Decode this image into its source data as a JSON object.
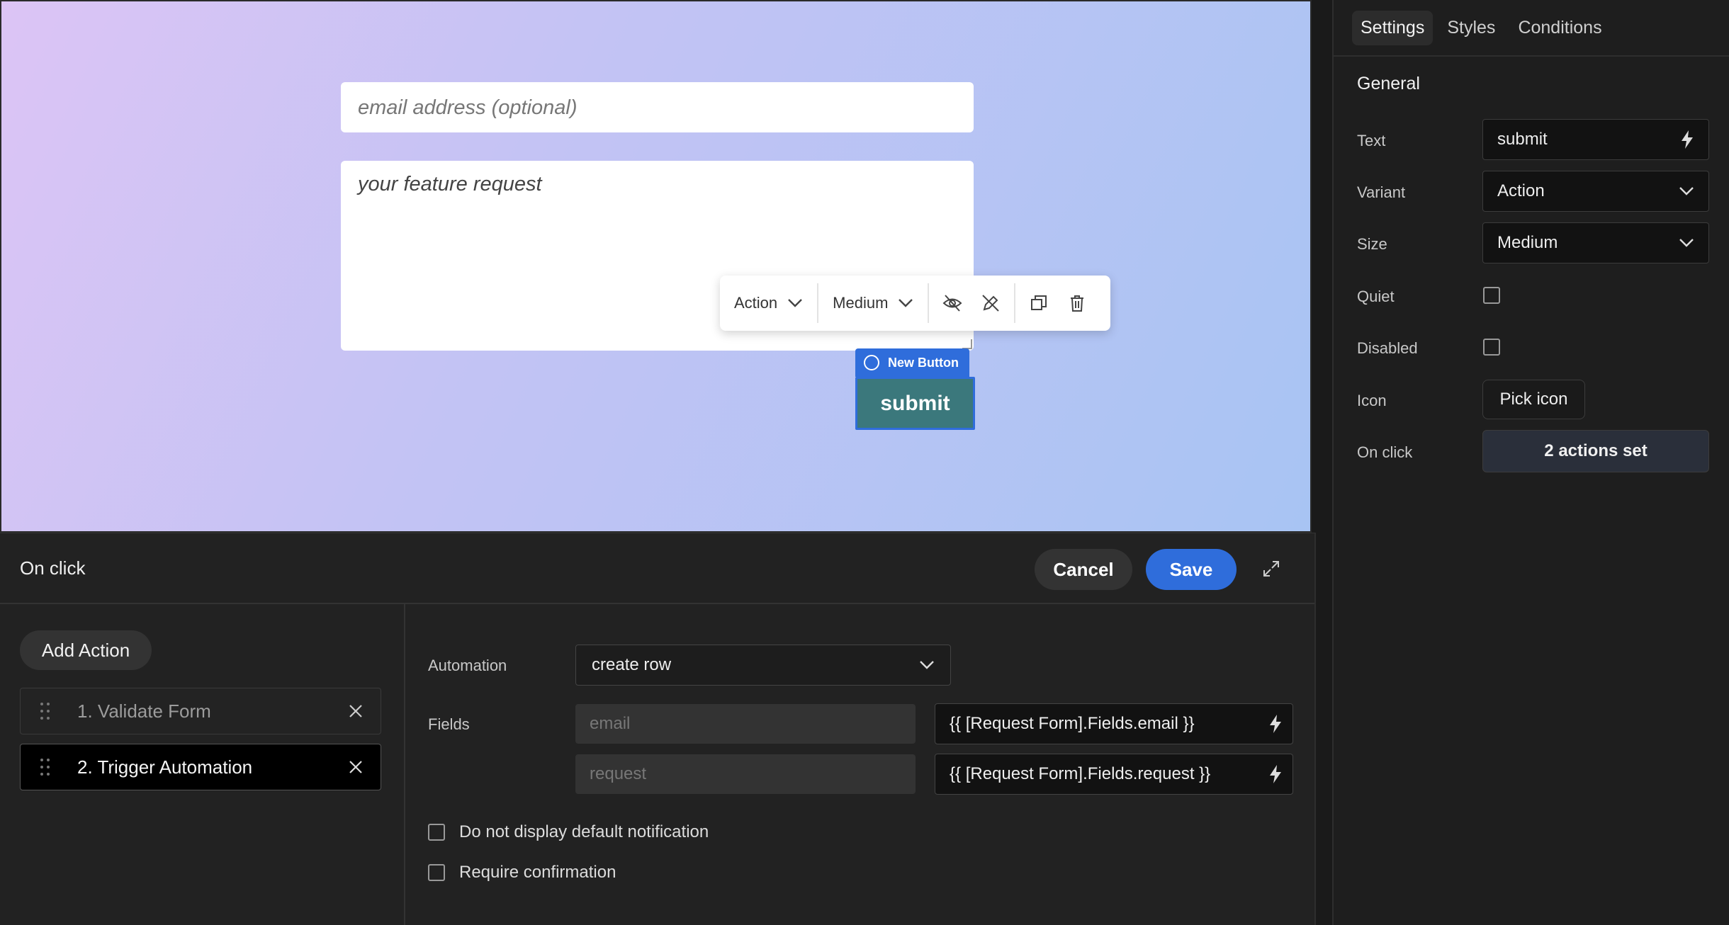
{
  "canvas": {
    "email_placeholder": "email address (optional)",
    "request_placeholder": "your feature request",
    "toolbar": {
      "variant_value": "Action",
      "size_value": "Medium",
      "icons": [
        "eye-off-icon",
        "pencil-off-icon",
        "duplicate-icon",
        "trash-icon"
      ]
    },
    "component_tag": "New Button",
    "submit_label": "submit"
  },
  "onclick_panel": {
    "title": "On click",
    "cancel_label": "Cancel",
    "save_label": "Save",
    "expand_icon": "expand-icon",
    "add_action_label": "Add Action",
    "actions": [
      {
        "label": "1. Validate Form"
      },
      {
        "label": "2. Trigger Automation"
      }
    ],
    "automation_label": "Automation",
    "automation_value": "create row",
    "fields_label": "Fields",
    "fields": [
      {
        "key_placeholder": "email",
        "value": "{{ [Request Form].Fields.email }}"
      },
      {
        "key_placeholder": "request",
        "value": "{{ [Request Form].Fields.request }}"
      }
    ],
    "options": [
      {
        "label": "Do not display default notification",
        "checked": false
      },
      {
        "label": "Require confirmation",
        "checked": false
      }
    ]
  },
  "settings": {
    "tabs": [
      "Settings",
      "Styles",
      "Conditions"
    ],
    "active_tab": "Settings",
    "section_title": "General",
    "text_label": "Text",
    "text_value": "submit",
    "variant_label": "Variant",
    "variant_value": "Action",
    "size_label": "Size",
    "size_value": "Medium",
    "quiet_label": "Quiet",
    "quiet_checked": false,
    "disabled_label": "Disabled",
    "disabled_checked": false,
    "icon_label": "Icon",
    "icon_button_label": "Pick icon",
    "onclick_label": "On click",
    "onclick_value": "2 actions set"
  },
  "colors": {
    "accent": "#2f6ddb",
    "submit_button": "#3b787c",
    "panel_bg": "#222222"
  }
}
